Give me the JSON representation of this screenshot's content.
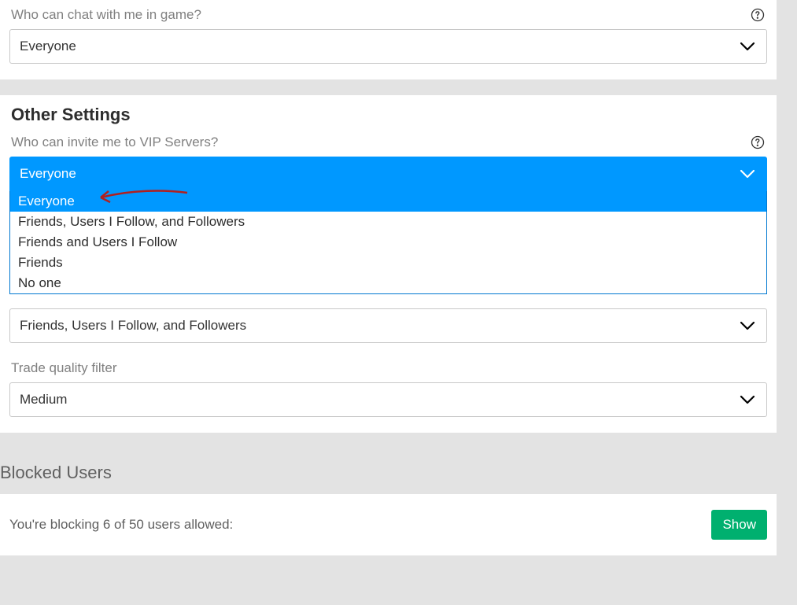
{
  "colors": {
    "accent": "#0098ff",
    "success": "#00b06f",
    "muted": "#808080"
  },
  "chat_section": {
    "label": "Who can chat with me in game?",
    "value": "Everyone"
  },
  "other_settings": {
    "title": "Other Settings",
    "vip": {
      "label": "Who can invite me to VIP Servers?",
      "value": "Everyone",
      "options": {
        "o0": "Everyone",
        "o1": "Friends, Users I Follow, and Followers",
        "o2": "Friends and Users I Follow",
        "o3": "Friends",
        "o4": "No one"
      }
    },
    "second_select": {
      "value": "Friends, Users I Follow, and Followers"
    },
    "trade_filter": {
      "label": "Trade quality filter",
      "value": "Medium"
    }
  },
  "blocked": {
    "title": "Blocked Users",
    "text": "You're blocking 6 of 50 users allowed:",
    "button": "Show"
  }
}
